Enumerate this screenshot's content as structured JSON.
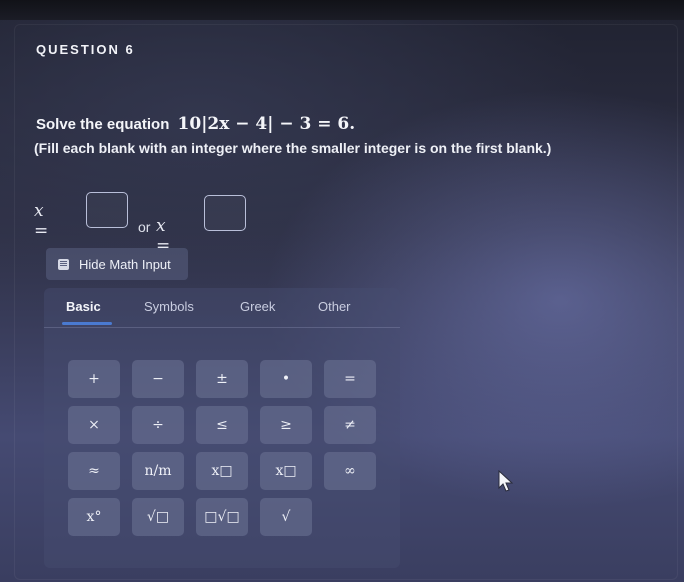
{
  "question": {
    "title": "QUESTION 6",
    "prompt_text": "Solve the equation",
    "equation": "10|2x − 4| − 3 = 6.",
    "instruction": "(Fill each blank with an integer where the smaller integer is on the first blank.)"
  },
  "answer": {
    "var1": "x =",
    "blank1_value": "",
    "or_label": "or",
    "var2": "x =",
    "blank2_value": ""
  },
  "hide_math_button": {
    "label": "Hide Math Input",
    "icon": "keyboard-icon"
  },
  "keyboard": {
    "tabs": [
      {
        "label": "Basic",
        "active": true
      },
      {
        "label": "Symbols",
        "active": false
      },
      {
        "label": "Greek",
        "active": false
      },
      {
        "label": "Other",
        "active": false
      }
    ],
    "keys": [
      [
        "+",
        "−",
        "±",
        "•",
        "="
      ],
      [
        "×",
        "÷",
        "≤",
        "≥",
        "≠"
      ],
      [
        "≈",
        "n/m",
        "x□",
        "x□",
        "∞"
      ],
      [
        "x°",
        "√□",
        "□√□",
        "√"
      ]
    ]
  },
  "accent_color": "#4a7ad0"
}
